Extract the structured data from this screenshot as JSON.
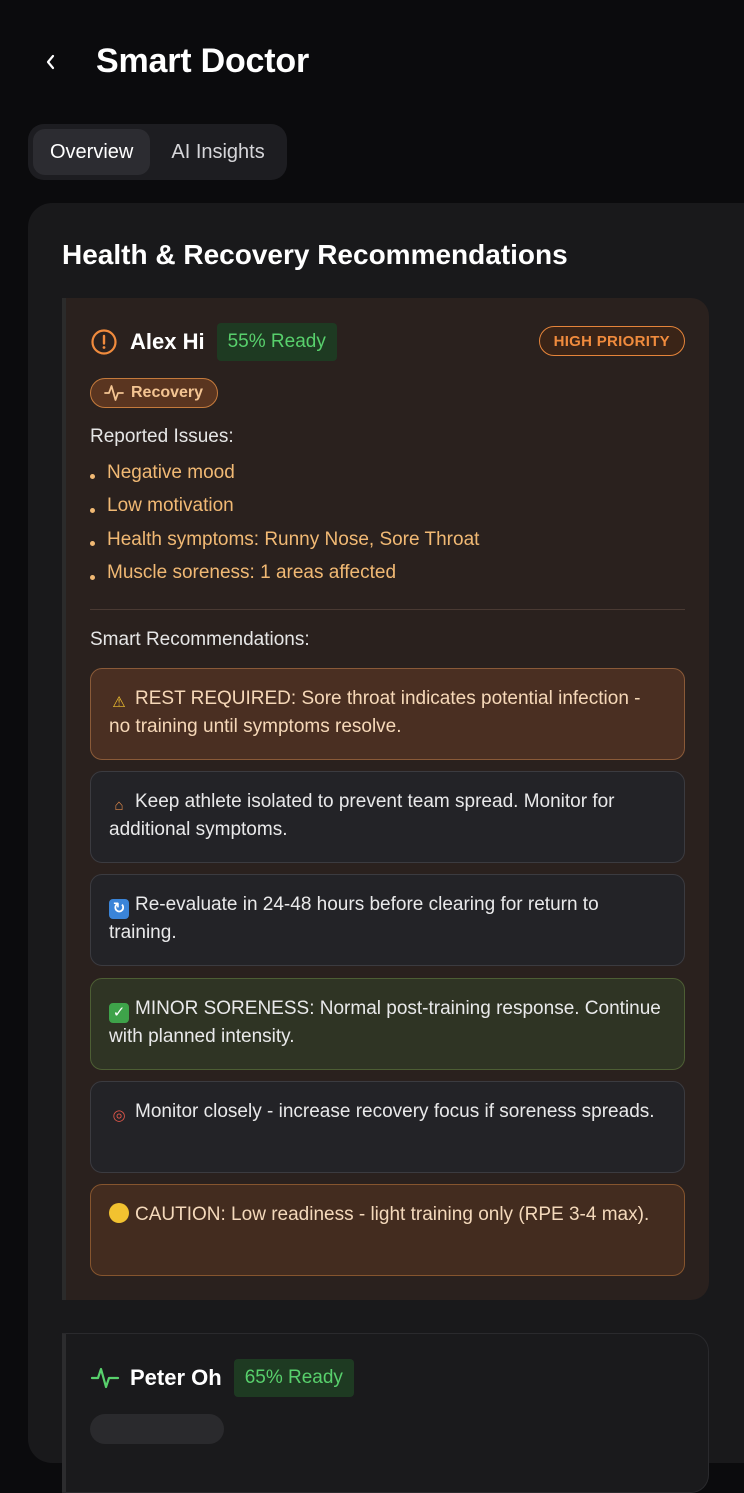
{
  "header": {
    "title": "Smart Doctor"
  },
  "tabs": [
    {
      "label": "Overview",
      "active": true
    },
    {
      "label": "AI Insights",
      "active": false
    }
  ],
  "panel": {
    "title": "Health & Recovery Recommendations"
  },
  "athletes": [
    {
      "name": "Alex Hi",
      "ready": "55% Ready",
      "priority": "HIGH PRIORITY",
      "category": "Recovery",
      "issues_label": "Reported Issues:",
      "issues": [
        "Negative mood",
        "Low motivation",
        "Health symptoms: Runny Nose, Sore Throat",
        "Muscle soreness: 1 areas affected"
      ],
      "recs_label": "Smart Recommendations:",
      "recommendations": [
        {
          "icon": "warning-icon",
          "text": "REST REQUIRED: Sore throat indicates potential infection - no training until symptoms resolve."
        },
        {
          "icon": "house-icon",
          "text": "Keep athlete isolated to prevent team spread. Monitor for additional symptoms."
        },
        {
          "icon": "refresh-icon",
          "text": "Re-evaluate in 24-48 hours before clearing for return to training."
        },
        {
          "icon": "check-icon",
          "text": "MINOR SORENESS: Normal post-training response. Continue with planned intensity."
        },
        {
          "icon": "target-icon",
          "text": "Monitor closely - increase recovery focus if soreness spreads."
        },
        {
          "icon": "yellow-circle-icon",
          "text": "CAUTION: Low readiness - light training only (RPE 3-4 max)."
        }
      ]
    },
    {
      "name": "Peter Oh",
      "ready": "65% Ready"
    }
  ],
  "colors": {
    "background": "#0b0b0d",
    "ready_green": "#58d06c",
    "priority_orange": "#f08b3d",
    "issue_text": "#f1b974"
  }
}
